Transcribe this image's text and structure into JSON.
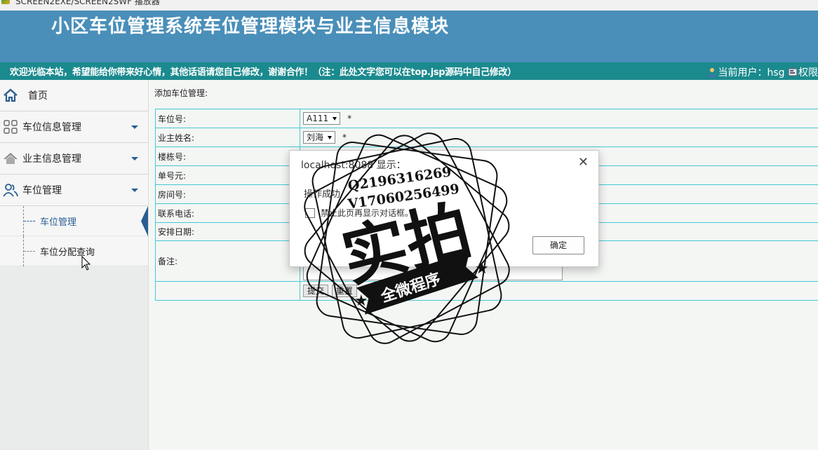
{
  "window": {
    "title": "SCREEN2EXE/SCREEN2SWF 播放器"
  },
  "header": {
    "title": "小区车位管理系统车位管理模块与业主信息模块",
    "marquee": "欢迎光临本站，希望能给你带来好心情，其他话语请您自己修改，谢谢合作！（注：此处文字您可以在top.jsp源码中自己修改）",
    "current_user_label": "当前用户：hsg",
    "permission_label": "权限"
  },
  "sidebar": {
    "home": "首页",
    "items": [
      {
        "label": "车位信息管理",
        "icon": "grid-icon"
      },
      {
        "label": "业主信息管理",
        "icon": "house-icon"
      },
      {
        "label": "车位管理",
        "icon": "users-icon"
      }
    ],
    "submenu": [
      {
        "label": "车位管理",
        "active": true
      },
      {
        "label": "车位分配查询",
        "active": false
      }
    ]
  },
  "main": {
    "heading": "添加车位管理:",
    "fields": [
      {
        "label": "车位号:",
        "value": "A111",
        "required": "*"
      },
      {
        "label": "业主姓名:",
        "value": "刘海",
        "required": "*"
      },
      {
        "label": "楼栋号:"
      },
      {
        "label": "单号元:"
      },
      {
        "label": "房间号:"
      },
      {
        "label": "联系电话:"
      },
      {
        "label": "安排日期:"
      },
      {
        "label": "备注:"
      }
    ],
    "submit": "提交",
    "reset": "重置"
  },
  "dialog": {
    "title": "localhost:8088 显示：",
    "message": "操作成功",
    "checkbox": "禁止此页再显示对话框。",
    "ok": "确定"
  },
  "watermark": {
    "line1": "Q2196316269",
    "line2": "V17060256499",
    "main": "实拍",
    "ribbon": "全微程序"
  }
}
